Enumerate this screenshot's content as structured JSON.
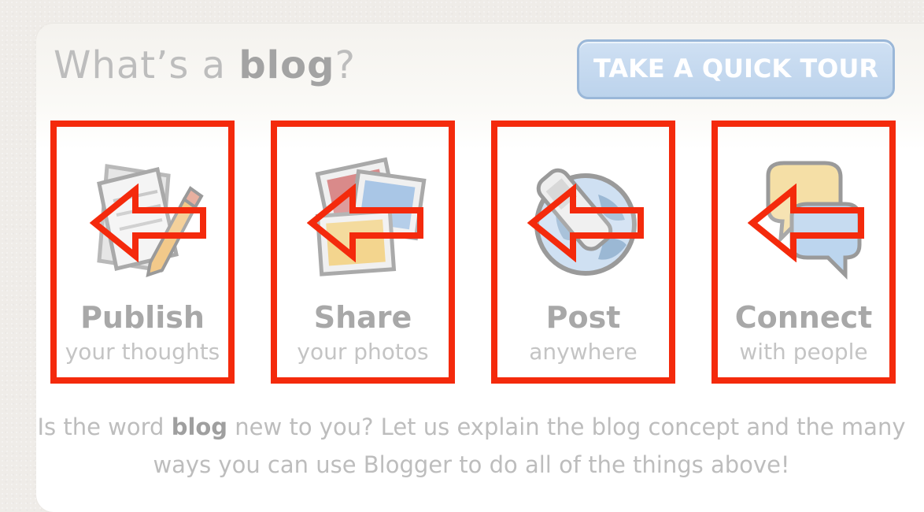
{
  "header": {
    "title_prefix": "What’s a ",
    "title_bold": "blog",
    "title_suffix": "?",
    "tour_button_label": "TAKE A QUICK TOUR"
  },
  "features": [
    {
      "title": "Publish",
      "subtitle": "your thoughts",
      "icon": "document-pencil-icon"
    },
    {
      "title": "Share",
      "subtitle": "your photos",
      "icon": "photos-icon"
    },
    {
      "title": "Post",
      "subtitle": "anywhere",
      "icon": "globe-phone-icon"
    },
    {
      "title": "Connect",
      "subtitle": "with people",
      "icon": "chat-bubbles-icon"
    }
  ],
  "description": {
    "part1": "Is the word ",
    "bold": "blog",
    "part2": " new to you? Let us explain the blog concept and the many ways you can use Blogger to do all of the things above!"
  },
  "colors": {
    "annotation_red": "#f42a0c",
    "tour_button_blue": "#bcd3ec",
    "muted_gray_text": "#a8a8a8"
  }
}
